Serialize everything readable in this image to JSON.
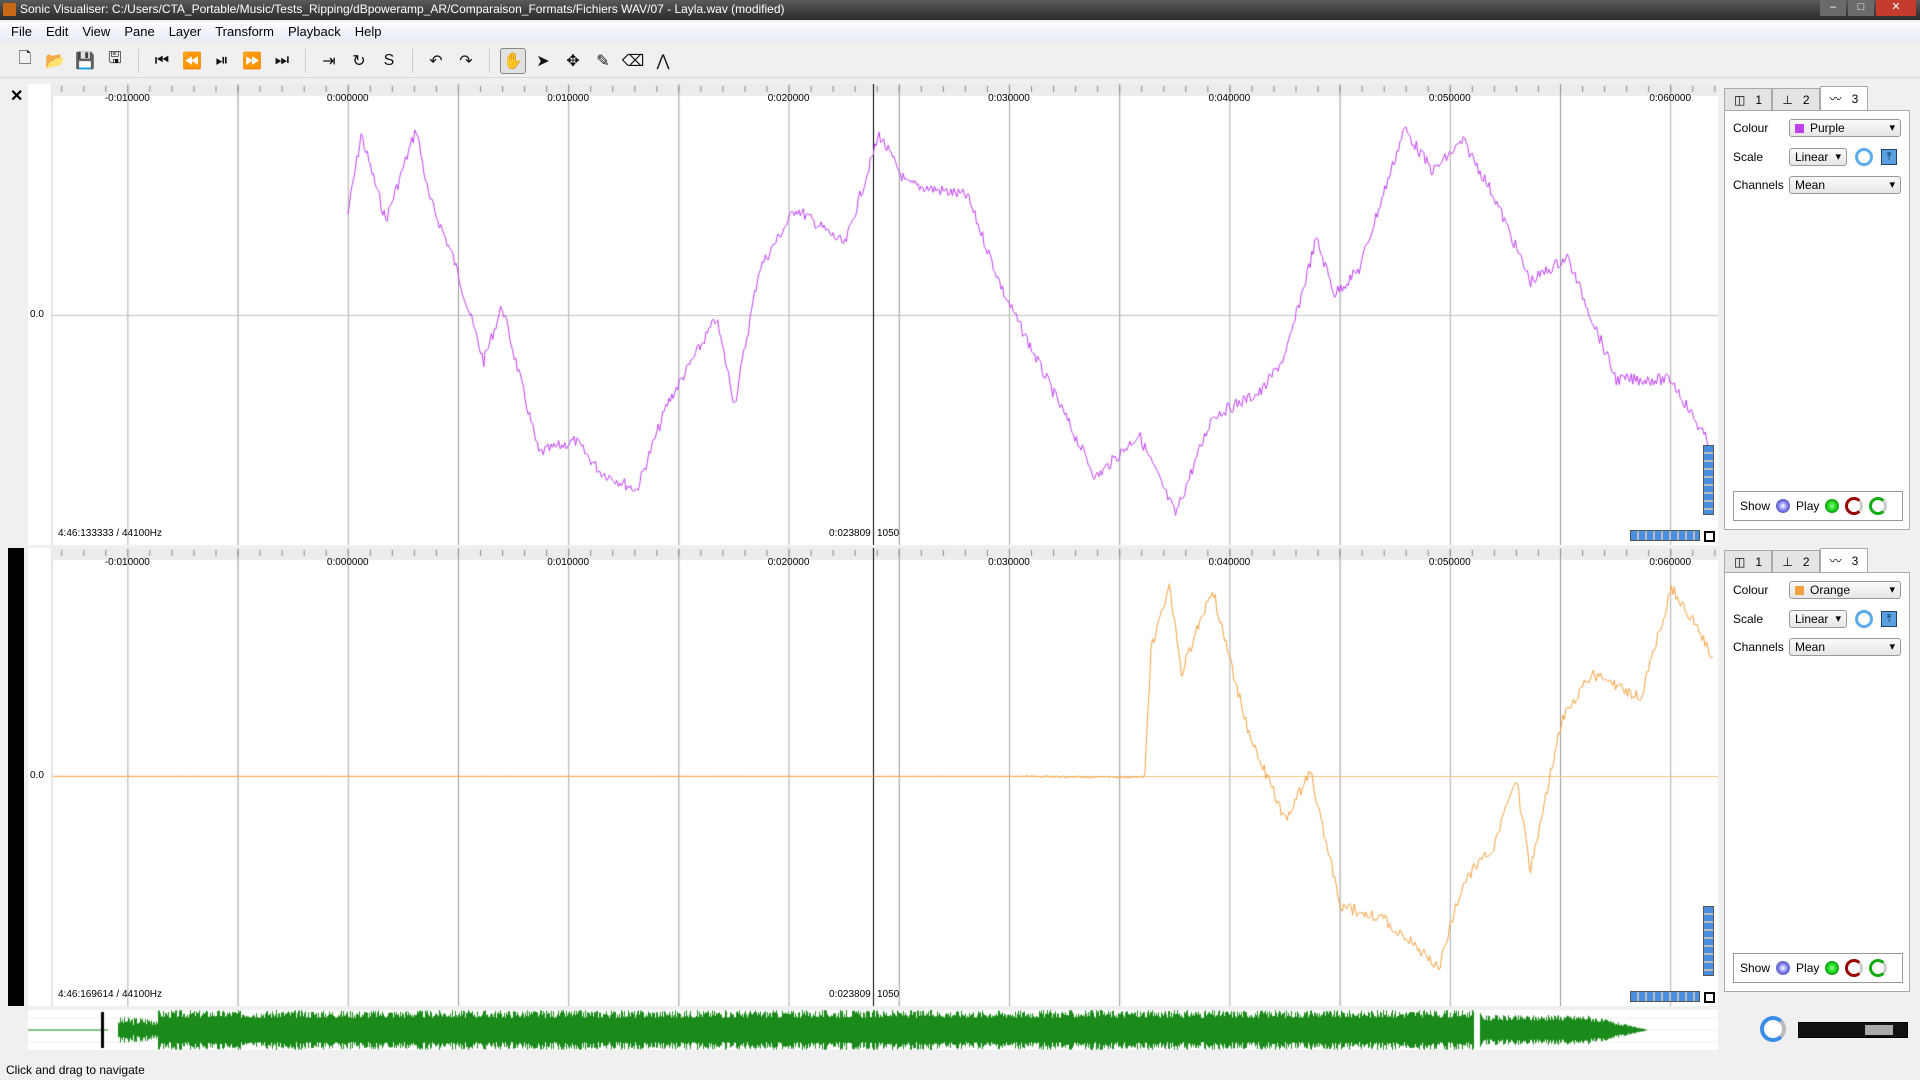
{
  "window": {
    "title": "Sonic Visualiser: C:/Users/CTA_Portable/Music/Tests_Ripping/dBpoweramp_AR/Comparaison_Formats/Fichiers WAV/07 - Layla.wav (modified)"
  },
  "menu": [
    "File",
    "Edit",
    "View",
    "Pane",
    "Layer",
    "Transform",
    "Playback",
    "Help"
  ],
  "toolbar": [
    {
      "icon": "new-file-icon",
      "g": "🗋"
    },
    {
      "icon": "open-icon",
      "g": "📂"
    },
    {
      "icon": "save-icon",
      "g": "💾"
    },
    {
      "icon": "save-session-icon",
      "g": "🖫"
    },
    {
      "sep": true
    },
    {
      "icon": "rewind-start-icon",
      "g": "⏮"
    },
    {
      "icon": "rewind-icon",
      "g": "⏪"
    },
    {
      "icon": "play-pause-icon",
      "g": "⏯"
    },
    {
      "icon": "fast-forward-icon",
      "g": "⏩"
    },
    {
      "icon": "ffwd-end-icon",
      "g": "⏭"
    },
    {
      "sep": true
    },
    {
      "icon": "play-selection-icon",
      "g": "⇥"
    },
    {
      "icon": "loop-icon",
      "g": "↻"
    },
    {
      "icon": "solo-icon",
      "g": "S"
    },
    {
      "sep": true
    },
    {
      "icon": "undo-icon",
      "g": "↶"
    },
    {
      "icon": "redo-icon",
      "g": "↷"
    },
    {
      "sep": true
    },
    {
      "icon": "navigate-hand-icon",
      "g": "✋",
      "active": true
    },
    {
      "icon": "select-arrow-icon",
      "g": "➤"
    },
    {
      "icon": "move-icon",
      "g": "✥"
    },
    {
      "icon": "draw-pencil-icon",
      "g": "✎"
    },
    {
      "icon": "erase-icon",
      "g": "⌫"
    },
    {
      "icon": "measure-icon",
      "g": "⋀"
    }
  ],
  "time_ticks": [
    "-0:010000",
    "0:000000",
    "0:010000",
    "0:020000",
    "0:030000",
    "0:040000",
    "0:050000",
    "0:060000"
  ],
  "panes": [
    {
      "zero_label": "0.0",
      "info": "4:46:133333 / 44100Hz",
      "cursor_time": "0:023809",
      "cursor_frame": "1050",
      "colour": "Purple",
      "colour_hex": "#c040f0",
      "scale": "Linear",
      "channels": "Mean"
    },
    {
      "zero_label": "0.0",
      "info": "4:46:169614 / 44100Hz",
      "cursor_time": "0:023809",
      "cursor_frame": "1050",
      "colour": "Orange",
      "colour_hex": "#f5a040",
      "scale": "Linear",
      "channels": "Mean"
    }
  ],
  "props": {
    "tabs": [
      "1",
      "2",
      "3"
    ],
    "colour_label": "Colour",
    "scale_label": "Scale",
    "channels_label": "Channels",
    "show_label": "Show",
    "play_label": "Play"
  },
  "overview_colour": "#1a8a1a",
  "status": "Click and drag to navigate"
}
